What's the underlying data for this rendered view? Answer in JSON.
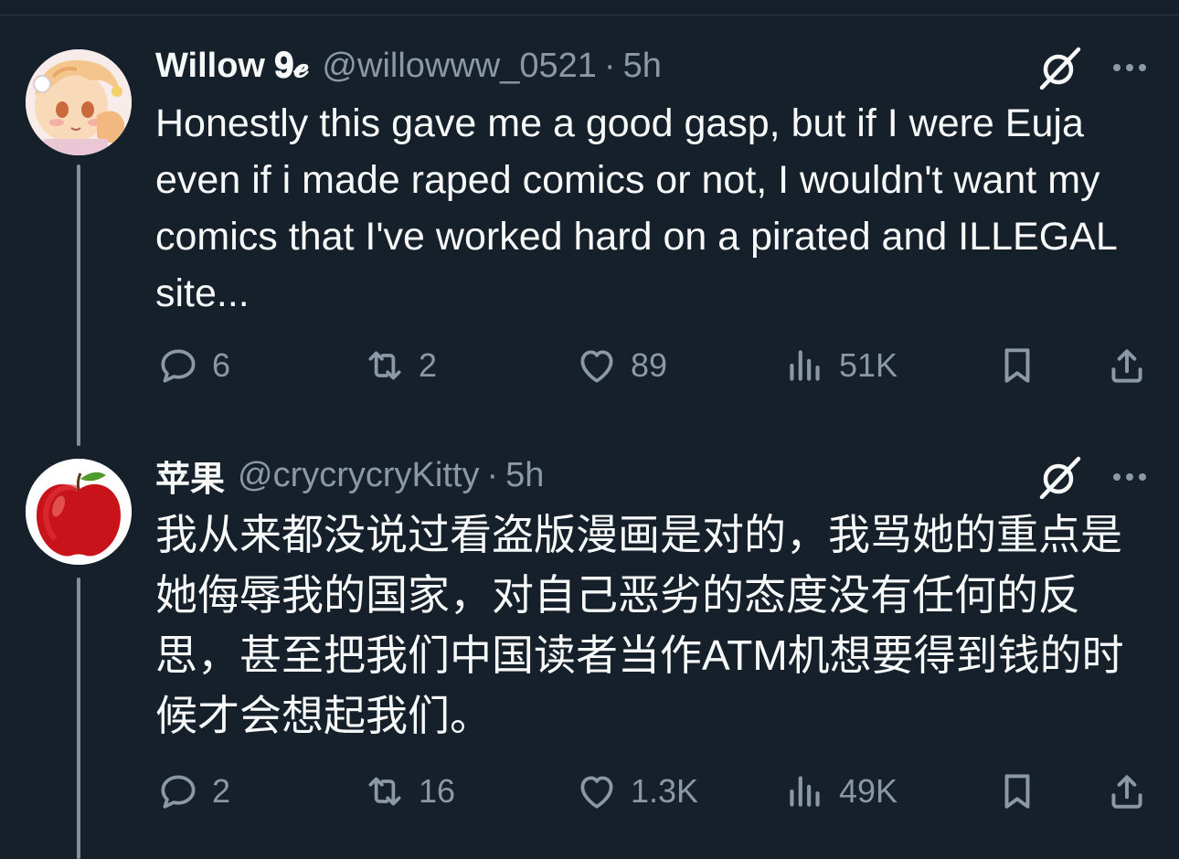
{
  "tweets": [
    {
      "display_name": "Willow 𝟗𝓮",
      "handle": "@willowww_0521",
      "separator": "·",
      "time": "5h",
      "text": "Honestly this gave me a good gasp, but if I were Euja even if i made raped comics or not, I wouldn't want my comics that I've worked hard on a pirated and ILLEGAL site...",
      "stats": {
        "replies": "6",
        "reposts": "2",
        "likes": "89",
        "views": "51K"
      }
    },
    {
      "display_name": "苹果",
      "handle": "@crycrycryKitty",
      "separator": "·",
      "time": "5h",
      "text": "我从来都没说过看盗版漫画是对的，我骂她的重点是她侮辱我的国家，对自己恶劣的态度没有任何的反思，甚至把我们中国读者当作ATM机想要得到钱的时候才会想起我们。",
      "stats": {
        "replies": "2",
        "reposts": "16",
        "likes": "1.3K",
        "views": "49K"
      }
    }
  ],
  "icons": {
    "reply": "reply-icon",
    "repost": "repost-icon",
    "like": "heart-icon",
    "views": "views-icon",
    "bookmark": "bookmark-icon",
    "share": "share-icon",
    "grok": "grok-icon",
    "more": "more-icon"
  },
  "colors": {
    "background": "#15202b",
    "text": "#f7f9f9",
    "muted": "#8b98a5",
    "thread_line": "#82909c"
  }
}
